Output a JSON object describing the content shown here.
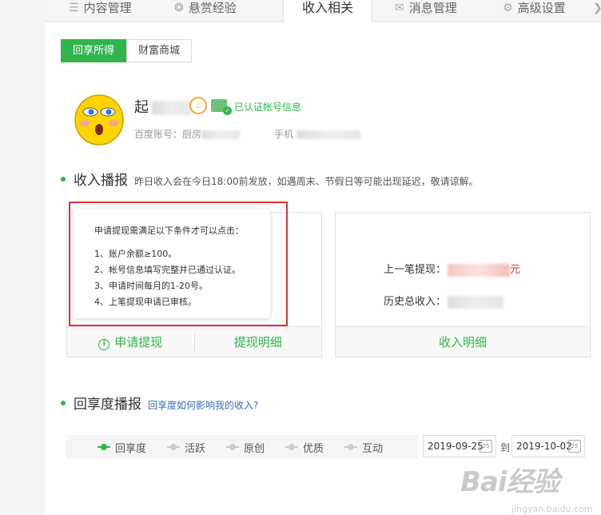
{
  "tabs": [
    {
      "label": "内容管理",
      "icon": "list-icon"
    },
    {
      "label": "悬赏经验",
      "icon": "medal-icon"
    },
    {
      "label": "收入相关",
      "icon": ""
    },
    {
      "label": "消息管理",
      "icon": "mail-icon"
    },
    {
      "label": "高级设置",
      "icon": "gear-icon"
    }
  ],
  "subtabs": [
    "回享所得",
    "财富商城"
  ],
  "profile": {
    "name_prefix": "起",
    "medal_glyph": "♨",
    "certified_text": "已认证帐号信息",
    "baidu_account_label": "百度账号：厨房",
    "phone_label": "手机"
  },
  "income": {
    "title": "收入播报",
    "notice": "昨日收入会在今日18:00前发放，如遇周末、节假日等可能出现延迟，敬请谅解。",
    "last_withdraw_label": "上一笔提现：",
    "last_withdraw_unit": "元",
    "history_total_label": "历史总收入：",
    "apply_withdraw": "申请提现",
    "withdraw_detail": "提现明细",
    "income_detail": "收入明细",
    "info_glyph": "i"
  },
  "tooltip": {
    "title": "申请提现需满足以下条件才可以点击：",
    "items": [
      "1、账户余额≥100。",
      "2、帐号信息填写完整并已通过认证。",
      "3、申请时间每月的1-20号。",
      "4、上笔提现申请已审核。"
    ]
  },
  "share": {
    "title": "回享度播报",
    "link": "回享度如何影响我的收入?",
    "filters": [
      "回享度",
      "活跃",
      "原创",
      "优质",
      "互动"
    ],
    "start_date": "2019-09-25",
    "to_label": "到",
    "end_date": "2019-10-02",
    "calendar_day": "25"
  },
  "watermark": {
    "logo": "Bai经验",
    "url": "jingyan.baidu.com"
  },
  "colors": {
    "accent": "#2fb54c",
    "highlight_box": "#e03232",
    "link": "#3a6fb5"
  }
}
